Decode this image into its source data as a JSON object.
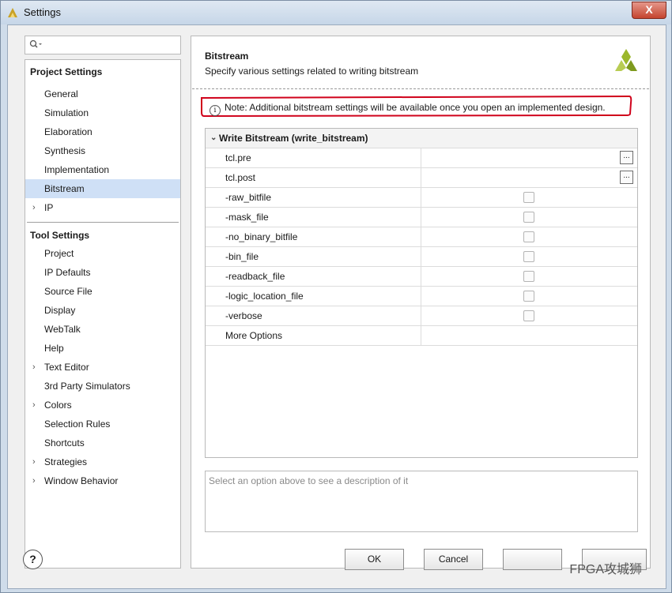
{
  "window": {
    "title": "Settings",
    "close_label": "X"
  },
  "search": {
    "placeholder": ""
  },
  "sidebar": {
    "project_settings_title": "Project Settings",
    "project_items": [
      {
        "label": "General"
      },
      {
        "label": "Simulation"
      },
      {
        "label": "Elaboration"
      },
      {
        "label": "Synthesis"
      },
      {
        "label": "Implementation"
      },
      {
        "label": "Bitstream",
        "selected": true
      },
      {
        "label": "IP",
        "expandable": true
      }
    ],
    "tool_settings_title": "Tool Settings",
    "tool_items": [
      {
        "label": "Project"
      },
      {
        "label": "IP Defaults"
      },
      {
        "label": "Source File"
      },
      {
        "label": "Display"
      },
      {
        "label": "WebTalk"
      },
      {
        "label": "Help"
      },
      {
        "label": "Text Editor",
        "expandable": true
      },
      {
        "label": "3rd Party Simulators"
      },
      {
        "label": "Colors",
        "expandable": true
      },
      {
        "label": "Selection Rules"
      },
      {
        "label": "Shortcuts"
      },
      {
        "label": "Strategies",
        "expandable": true
      },
      {
        "label": "Window Behavior",
        "expandable": true
      }
    ]
  },
  "main": {
    "title": "Bitstream",
    "subtitle": "Specify various settings related to writing bitstream",
    "note": "Note: Additional bitstream settings will be available once you open an implemented design.",
    "group_label": "Write Bitstream (write_bitstream)",
    "rows": [
      {
        "name": "tcl.pre",
        "type": "browse"
      },
      {
        "name": "tcl.post",
        "type": "browse"
      },
      {
        "name": "-raw_bitfile",
        "type": "checkbox"
      },
      {
        "name": "-mask_file",
        "type": "checkbox"
      },
      {
        "name": "-no_binary_bitfile",
        "type": "checkbox"
      },
      {
        "name": "-bin_file",
        "type": "checkbox"
      },
      {
        "name": "-readback_file",
        "type": "checkbox"
      },
      {
        "name": "-logic_location_file",
        "type": "checkbox"
      },
      {
        "name": "-verbose",
        "type": "checkbox"
      },
      {
        "name": "More Options",
        "type": "text"
      }
    ],
    "browse_label": "...",
    "description_placeholder": "Select an option above to see a description of it"
  },
  "footer": {
    "help_label": "?",
    "ok_label": "OK",
    "cancel_label": "Cancel",
    "watermark": "FPGA攻城狮"
  },
  "colors": {
    "selection": "#cfe0f6",
    "highlight_ring": "#d0021b",
    "logo": "#9bb72c"
  }
}
